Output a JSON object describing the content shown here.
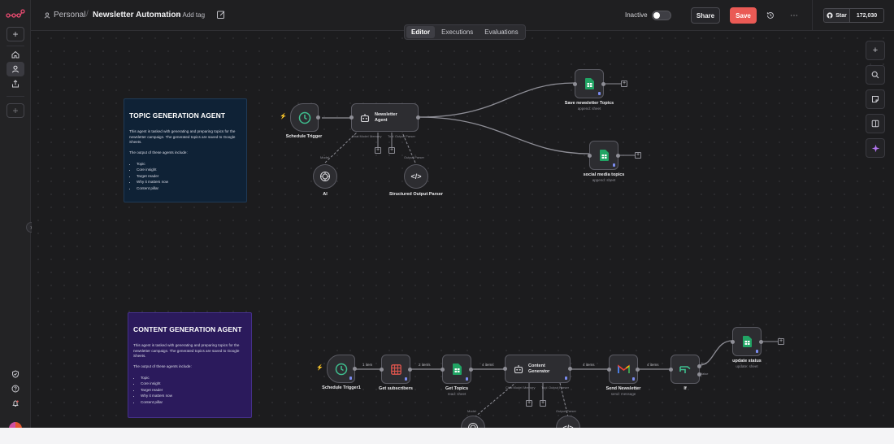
{
  "header": {
    "project": "Personal",
    "workflow_name": "Newsletter Automation",
    "add_tag": "+ Add tag",
    "status_label": "Inactive",
    "share": "Share",
    "save": "Save",
    "github_star": "Star",
    "github_count": "172,030"
  },
  "tabs": [
    {
      "label": "Editor",
      "active": true
    },
    {
      "label": "Executions",
      "active": false
    },
    {
      "label": "Evaluations",
      "active": false
    }
  ],
  "colors": {
    "save": "#ea5a55",
    "sticky_topic": "#0f2236",
    "sticky_content": "#2b1a5c",
    "sheets_green": "#21a464",
    "ai_accent": "#b476f2"
  },
  "stickies": {
    "topic": {
      "title": "TOPIC GENERATION AGENT",
      "body": "This agent is tasked with generating and preparing topics for the newsletter campaign. The generated topics are saved to Google Sheets.",
      "outputs_intro": "The output of these agents include:",
      "items": [
        "Topic",
        "Core insight",
        "Target reader",
        "Why it matters now",
        "Content pillar"
      ]
    },
    "content": {
      "title": "CONTENT GENERATION AGENT",
      "body": "This agent is tasked with generating and preparing topics for the newsletter campaign. The generated topics are saved to Google Sheets.",
      "outputs_intro": "The output of these agents include:",
      "items": [
        "Topic",
        "Core insight",
        "Target reader",
        "Why it matters now",
        "Content pillar"
      ]
    }
  },
  "nodes": {
    "schedule_trigger": {
      "label": "Schedule Trigger"
    },
    "newsletter_agent": {
      "label": "Newsletter Agent",
      "port_chat": "Chat Model",
      "port_memory": "Memory",
      "port_tool": "Tool",
      "port_parser": "Output Parser"
    },
    "ai_model": {
      "label": "AI",
      "port": "Model"
    },
    "structured_parser": {
      "label": "Structured Output Parser",
      "port": "Output Parser"
    },
    "save_topics": {
      "label": "Save newsletter Topics",
      "sub": "append: sheet"
    },
    "social_topics": {
      "label": "social media topics",
      "sub": "append: sheet"
    },
    "schedule_trigger1": {
      "label": "Schedule Trigger1"
    },
    "get_subscribers": {
      "label": "Get subscribers"
    },
    "get_topics": {
      "label": "Get Topics",
      "sub": "read: sheet"
    },
    "content_generator": {
      "label": "Content Generator",
      "port_chat": "Chat Model",
      "port_memory": "Memory",
      "port_tool": "Tool",
      "port_parser": "Output Parser"
    },
    "send_newsletter": {
      "label": "Send Newsletter",
      "sub": "send: message"
    },
    "if_node": {
      "label": "If",
      "true": "true",
      "false": "false"
    },
    "update_status": {
      "label": "update status",
      "sub": "update: sheet"
    },
    "bottom_model": {
      "port": "Model"
    },
    "bottom_parser": {
      "port": "Output Parser"
    }
  },
  "edge_labels": {
    "e1": "1 item",
    "e2": "2 items",
    "e3": "4 items",
    "e4": "4 items",
    "e5": "4 items"
  },
  "icons": {
    "logo": "n8n-logo-icon",
    "add": "plus-icon",
    "home": "home-icon",
    "user": "user-icon",
    "share": "share-icon",
    "templates": "shield-icon",
    "help": "help-icon",
    "notifications": "bell-icon",
    "zoom": "search-icon",
    "sticky": "sticky-note-icon",
    "panel": "panel-icon",
    "ai_assistant": "sparkle-icon"
  }
}
